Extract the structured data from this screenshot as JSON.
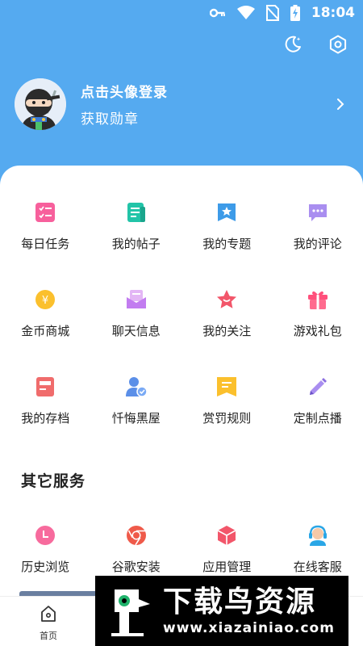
{
  "status_bar": {
    "time": "18:04"
  },
  "profile": {
    "login_prompt": "点击头像登录",
    "medal_text": "获取勋章"
  },
  "main_menu": [
    {
      "label": "每日任务",
      "icon": "checklist-icon"
    },
    {
      "label": "我的帖子",
      "icon": "document-icon"
    },
    {
      "label": "我的专题",
      "icon": "bookmark-star-icon"
    },
    {
      "label": "我的评论",
      "icon": "comment-icon"
    },
    {
      "label": "金币商城",
      "icon": "coin-icon"
    },
    {
      "label": "聊天信息",
      "icon": "mail-icon"
    },
    {
      "label": "我的关注",
      "icon": "star-icon"
    },
    {
      "label": "游戏礼包",
      "icon": "gift-icon"
    },
    {
      "label": "我的存档",
      "icon": "archive-icon"
    },
    {
      "label": "忏悔黑屋",
      "icon": "user-lock-icon"
    },
    {
      "label": "赏罚规则",
      "icon": "rules-icon"
    },
    {
      "label": "定制点播",
      "icon": "pencil-icon"
    }
  ],
  "other_services": {
    "title": "其它服务",
    "items": [
      {
        "label": "历史浏览",
        "icon": "clock-icon"
      },
      {
        "label": "谷歌安装",
        "icon": "chrome-icon"
      },
      {
        "label": "应用管理",
        "icon": "cube-icon"
      },
      {
        "label": "在线客服",
        "icon": "headset-icon"
      }
    ]
  },
  "bottom_nav": {
    "home_label": "首页"
  },
  "watermark": {
    "main": "下载鸟资源",
    "url": "www.xiazainiao.com"
  },
  "colors": {
    "header_bg": "#55aaf0",
    "card_bg": "#ffffff",
    "text": "#222222"
  }
}
